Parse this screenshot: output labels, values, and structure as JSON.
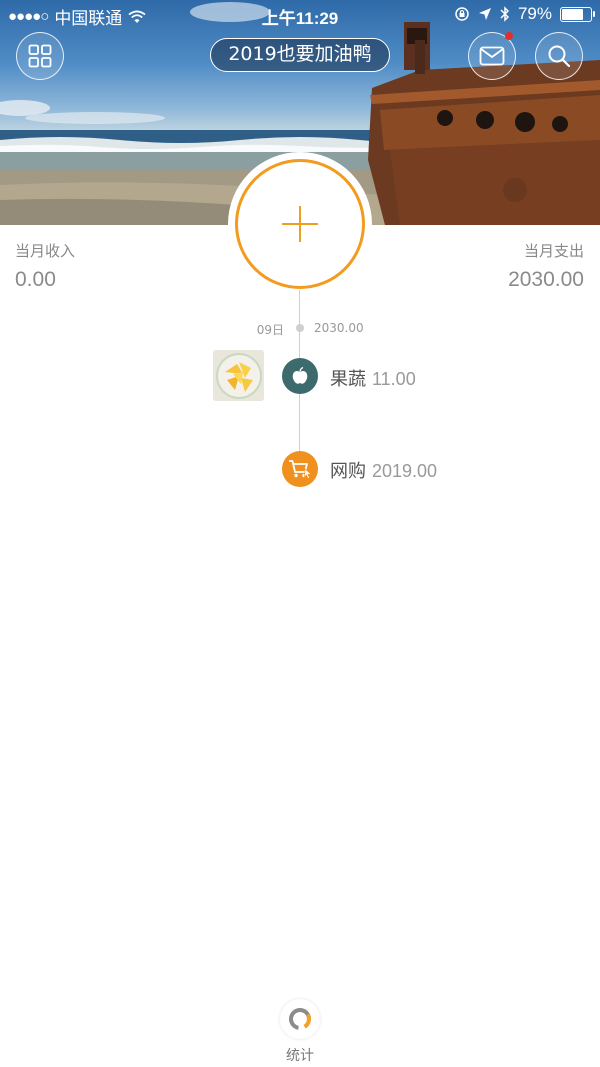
{
  "status_bar": {
    "carrier": "中国联通",
    "signal_dots": "●●●●○",
    "time": "上午11:29",
    "battery_percent": "79%",
    "battery_level": 0.79
  },
  "header": {
    "book_title": "2019也要加油鸭",
    "mail_has_notification": true
  },
  "summary": {
    "income_label": "当月收入",
    "income_value": "0.00",
    "expense_label": "当月支出",
    "expense_value": "2030.00"
  },
  "timeline": {
    "day_label": "09日",
    "day_total": "2030.00",
    "entries": [
      {
        "category": "果蔬",
        "amount": "11.00",
        "icon": "apple-icon",
        "icon_color": "#3d6a6d",
        "has_photo": true
      },
      {
        "category": "网购",
        "amount": "2019.00",
        "icon": "shopping-cart-icon",
        "icon_color": "#f0901e",
        "has_photo": false
      }
    ]
  },
  "bottom": {
    "stats_label": "统计"
  },
  "colors": {
    "accent": "#f29b1e",
    "text_muted": "#8a8a8a"
  }
}
